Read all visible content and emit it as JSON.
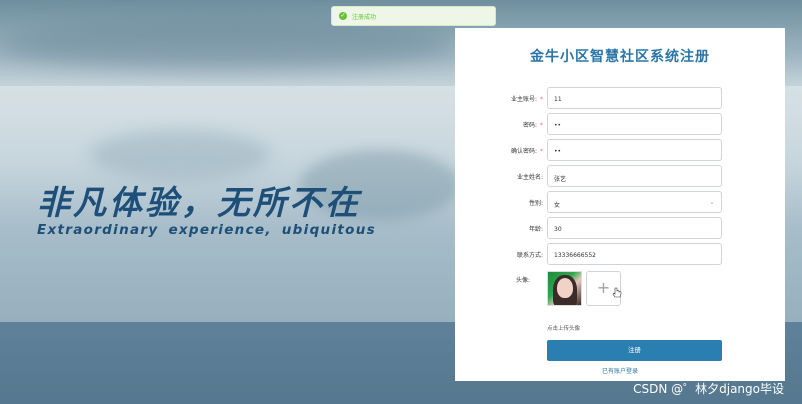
{
  "toast": {
    "message": "注册成功",
    "icon": "check-circle-icon",
    "color": "#67c23a"
  },
  "hero": {
    "title": "非凡体验，无所不在",
    "subtitle": "Extraordinary experience, ubiquitous"
  },
  "form": {
    "title": "金牛小区智慧社区系统注册",
    "fields": [
      {
        "label": "业主账号:",
        "value": "11",
        "required": true
      },
      {
        "label": "密码:",
        "value": "••",
        "required": true
      },
      {
        "label": "确认密码:",
        "value": "••",
        "required": true
      },
      {
        "label": "业主姓名:",
        "value": "张艺",
        "required": false
      },
      {
        "label": "性别:",
        "value": "女",
        "required": false,
        "type": "select"
      },
      {
        "label": "年龄:",
        "value": "30",
        "required": false
      },
      {
        "label": "联系方式:",
        "value": "13336666552",
        "required": false
      }
    ],
    "avatar_label": "头像:",
    "upload_hint": "点击上传头像",
    "upload_plus": "+",
    "submit_label": "注册",
    "login_link": "已有账户登录",
    "accent_color": "#2b7fb0"
  },
  "watermark": "CSDN @゜林夕django毕设"
}
